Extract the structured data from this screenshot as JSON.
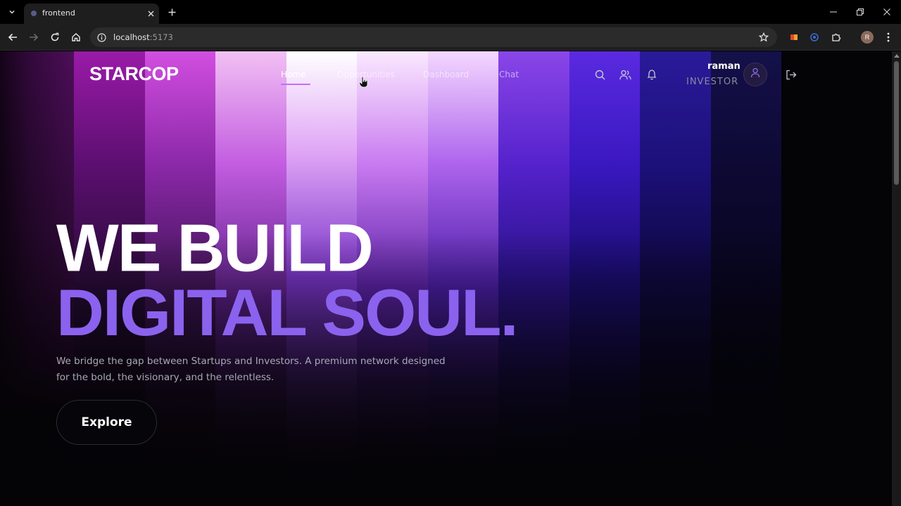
{
  "browser": {
    "tab_title": "frontend",
    "url_host": "localhost",
    "url_port": ":5173",
    "profile_initial": "R"
  },
  "site": {
    "logo": "STARCOP",
    "nav": [
      {
        "label": "Home",
        "active": true
      },
      {
        "label": "Opportunities",
        "active": false
      },
      {
        "label": "Dashboard",
        "active": false
      },
      {
        "label": "Chat",
        "active": false
      }
    ],
    "user": {
      "name": "raman",
      "role": "INVESTOR"
    }
  },
  "hero": {
    "line1": "WE BUILD",
    "line2": "DIGITAL SOUL.",
    "subtitle": "We bridge the gap between Startups and Investors. A premium network designed for the bold, the visionary, and the relentless.",
    "cta": "Explore"
  },
  "colors": {
    "accent": "#8b62ee",
    "nav_underline": "#c86cff",
    "background": "#040306"
  },
  "icons": [
    "search-icon",
    "users-icon",
    "bell-icon",
    "user-icon",
    "logout-icon"
  ]
}
